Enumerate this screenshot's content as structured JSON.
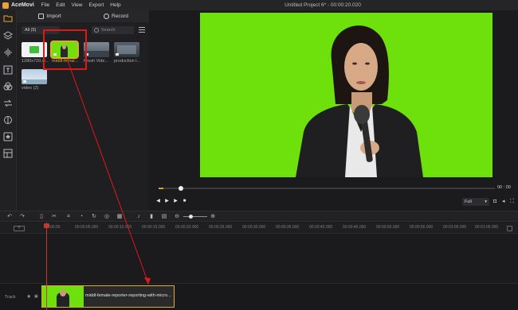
{
  "app": {
    "name": "AceMovi",
    "menu": [
      "File",
      "Edit",
      "View",
      "Export",
      "Help"
    ],
    "window_title": "Untitled Project 6* - 00:00:20.020"
  },
  "left_rail": {
    "icons": [
      "folder-icon",
      "layers-icon",
      "audio-wave-icon",
      "text-icon",
      "effects-icon",
      "transition-icon",
      "filter-icon",
      "sticker-icon",
      "template-icon"
    ]
  },
  "media_panel": {
    "tabs": [
      {
        "label": "Import",
        "icon": "import-icon"
      },
      {
        "label": "Record",
        "icon": "record-icon"
      }
    ],
    "filter_label": "All (5)",
    "search_placeholder": "Search",
    "items": [
      {
        "label": "1280x720.w...",
        "selected": false
      },
      {
        "label": "middl-femal...",
        "selected": true
      },
      {
        "label": "Fresh Vide...",
        "selected": false
      },
      {
        "label": "production l...",
        "selected": false
      },
      {
        "label": "video (2)",
        "selected": false
      }
    ]
  },
  "preview": {
    "timecode": "00 : 00",
    "zoom": "Full",
    "progress": 0.01
  },
  "timeline": {
    "ruler_ticks": [
      "00:00:00",
      "00:00:05.000",
      "00:00:10.000",
      "00:00:15.000",
      "00:00:20.000",
      "00:00:25.000",
      "00:00:30.000",
      "00:00:35.000",
      "00:00:40.000",
      "00:00:45.000",
      "00:00:50.000",
      "00:00:55.000",
      "00:01:00.000",
      "00:01:05.000",
      "00:01:10.000"
    ],
    "track_label": "Track",
    "clip_label": "middl-female-reporter-reporting-with-micro..."
  },
  "colors": {
    "accent": "#e3aa2e",
    "green_screen": "#6ee00b",
    "annotation": "#e01818"
  }
}
